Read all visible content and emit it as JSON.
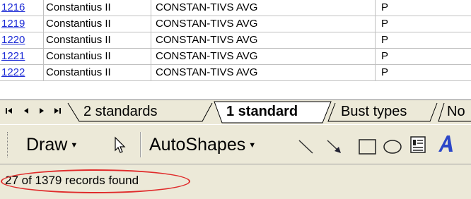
{
  "grid": {
    "rows": [
      {
        "id": "1216",
        "emperor": "Constantius II",
        "legend": "CONSTAN-TIVS AVG",
        "category": "P"
      },
      {
        "id": "1219",
        "emperor": "Constantius II",
        "legend": "CONSTAN-TIVS AVG",
        "category": "P"
      },
      {
        "id": "1220",
        "emperor": "Constantius II",
        "legend": "CONSTAN-TIVS AVG",
        "category": "P"
      },
      {
        "id": "1221",
        "emperor": "Constantius II",
        "legend": "CONSTAN-TIVS AVG",
        "category": "P"
      },
      {
        "id": "1222",
        "emperor": "Constantius II",
        "legend": "CONSTAN-TIVS AVG",
        "category": "P"
      }
    ]
  },
  "sheet_tabs": {
    "nav": {
      "first": "first-sheet-icon",
      "prev": "prev-sheet-icon",
      "next": "next-sheet-icon",
      "last": "last-sheet-icon"
    },
    "tabs": [
      {
        "label": "2 standards",
        "active": false
      },
      {
        "label": "1 standard",
        "active": true
      },
      {
        "label": "Bust types",
        "active": false
      },
      {
        "label": "No",
        "active": false
      }
    ]
  },
  "toolbar": {
    "draw_label": "Draw",
    "autoshapes_label": "AutoShapes",
    "icons": [
      "select-objects-arrow-icon",
      "line-icon",
      "arrow-icon",
      "rectangle-icon",
      "oval-icon",
      "text-box-icon",
      "wordart-icon"
    ]
  },
  "status": {
    "text": "27 of 1379 records found",
    "highlight_color": "#e02b2b"
  },
  "colors": {
    "link": "#1c2bd6",
    "chrome": "#ece9d8"
  }
}
